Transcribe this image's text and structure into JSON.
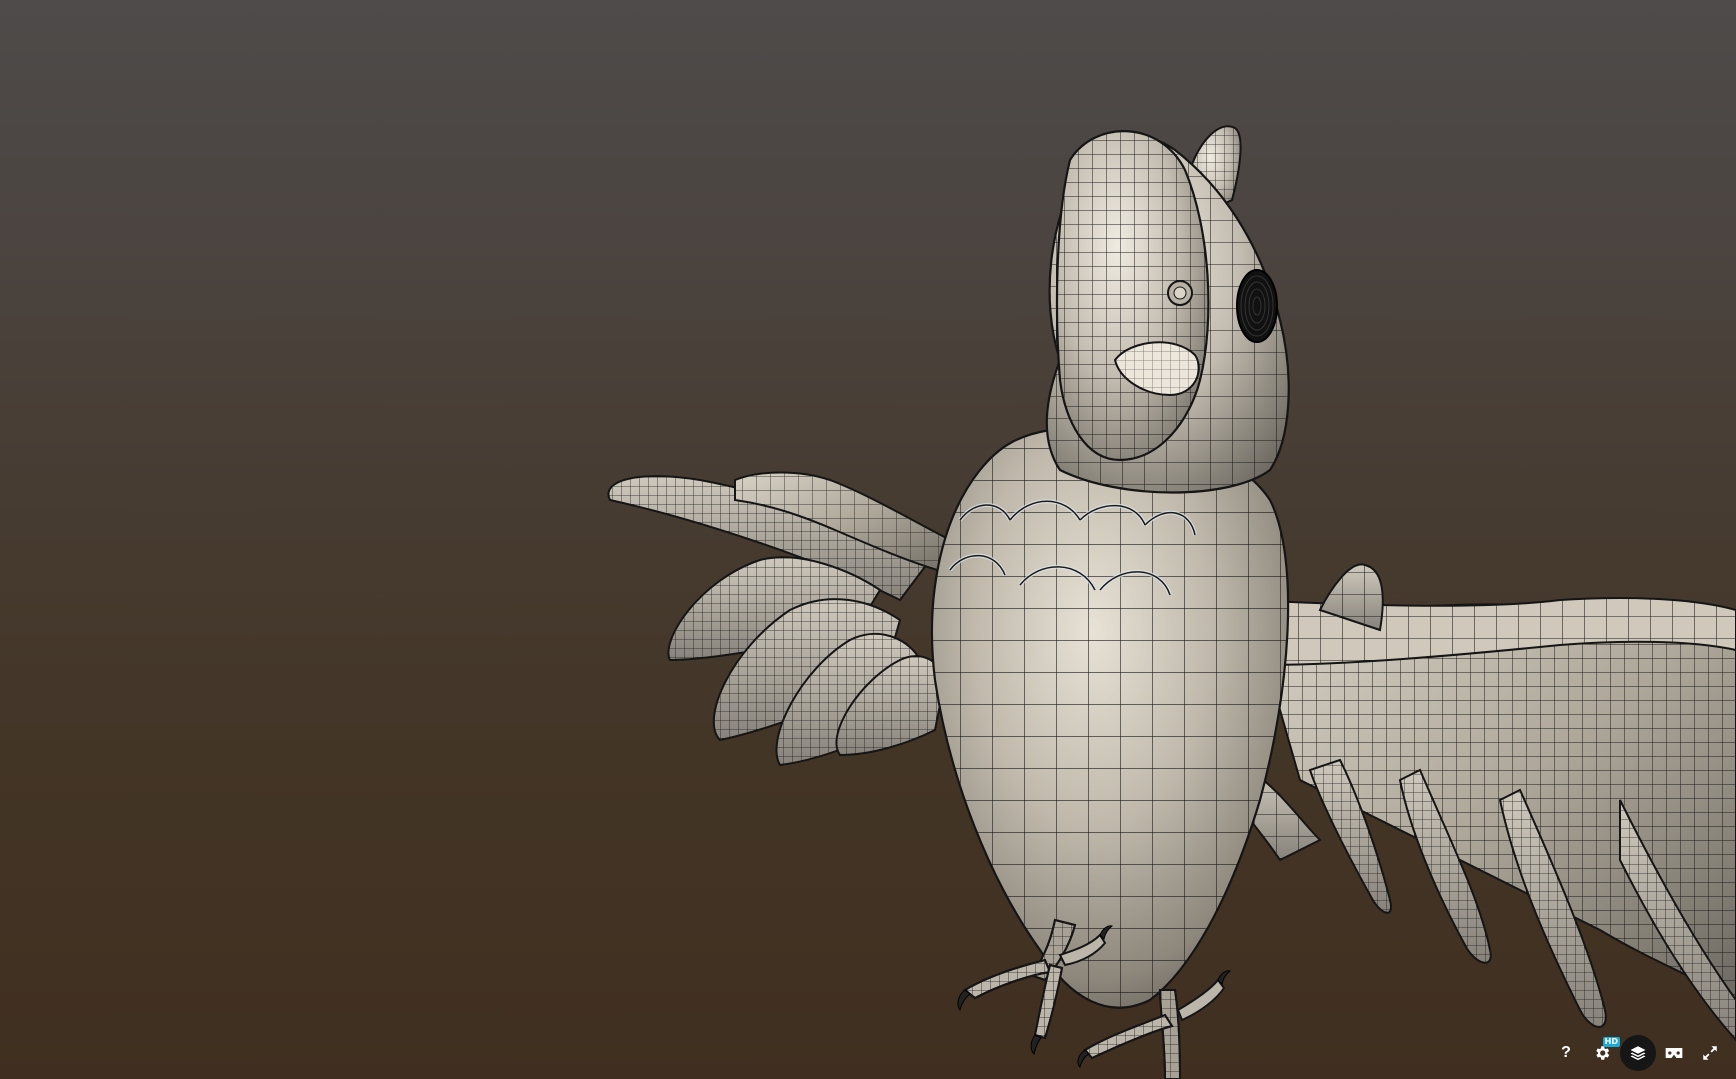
{
  "viewer": {
    "subject": "parrot-model-wireframe",
    "colors": {
      "background_top": "#4e4b4a",
      "background_bottom": "#402f20",
      "model_fill": "#b9b3a8",
      "model_shadow": "#6f6b63",
      "wire": "#1a1a1a"
    }
  },
  "controls": {
    "help_label": "?",
    "hd_badge": "HD",
    "icons": [
      "help-icon",
      "settings-icon",
      "layers-icon",
      "vr-icon",
      "fullscreen-icon"
    ]
  }
}
